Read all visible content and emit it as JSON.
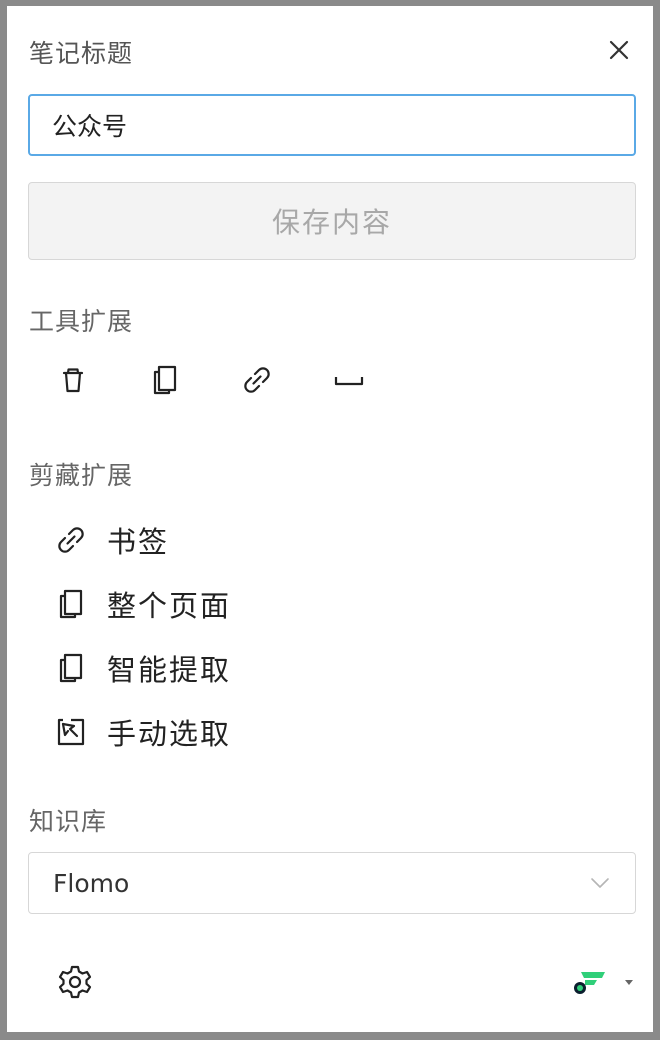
{
  "header": {
    "title": "笔记标题",
    "close_icon": "close-icon"
  },
  "title_input": {
    "value": "公众号",
    "placeholder": ""
  },
  "save_button": {
    "label": "保存内容"
  },
  "tools_section": {
    "label": "工具扩展",
    "items": [
      {
        "icon": "trash-icon"
      },
      {
        "icon": "copy-icon"
      },
      {
        "icon": "link-icon"
      },
      {
        "icon": "space-icon"
      }
    ]
  },
  "clip_section": {
    "label": "剪藏扩展",
    "items": [
      {
        "icon": "link-icon",
        "label": "书签"
      },
      {
        "icon": "page-icon",
        "label": "整个页面"
      },
      {
        "icon": "page-icon",
        "label": "智能提取"
      },
      {
        "icon": "select-icon",
        "label": "手动选取"
      }
    ]
  },
  "knowledge_base": {
    "label": "知识库",
    "selected": "Flomo"
  },
  "footer": {
    "settings_icon": "gear-icon",
    "brand_icon": "flomo-logo-icon",
    "menu_icon": "caret-down-icon"
  },
  "colors": {
    "input_border": "#5aa9e6",
    "brand_green": "#30cf79",
    "brand_dark": "#0b1f2e"
  }
}
